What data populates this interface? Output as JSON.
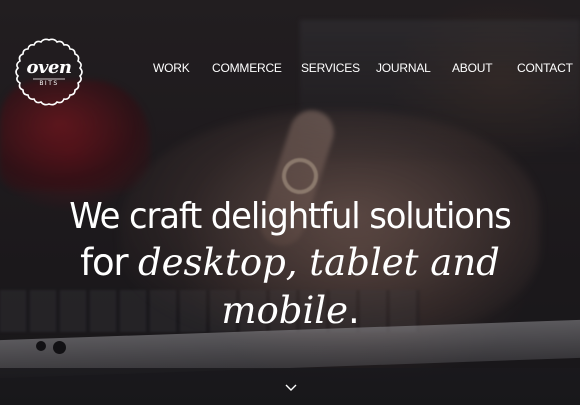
{
  "brand": {
    "logo_word": "oven",
    "logo_sub": "BITS",
    "icon": "scalloped-badge-icon"
  },
  "nav": {
    "items": [
      {
        "label": "WORK"
      },
      {
        "label": "COMMERCE"
      },
      {
        "label": "SERVICES"
      },
      {
        "label": "JOURNAL"
      },
      {
        "label": "ABOUT"
      },
      {
        "label": "CONTACT"
      }
    ]
  },
  "hero": {
    "line1": "We craft delightful solutions",
    "line2_plain": "for ",
    "line2_emphasis": "desktop, tablet and",
    "line3_emphasis": "mobile",
    "line3_plain": ".",
    "scroll_icon": "chevron-down-icon"
  },
  "colors": {
    "text": "#ffffff",
    "accent_cup": "#8a1a24",
    "background": "#1f1c1f"
  }
}
